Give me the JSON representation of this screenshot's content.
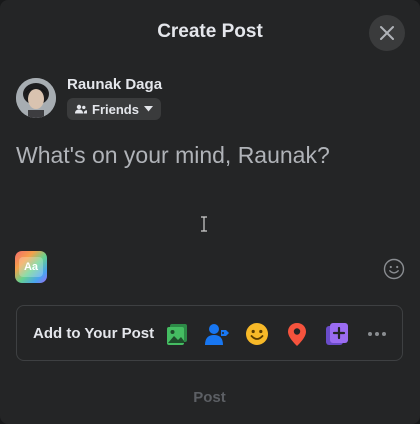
{
  "dialog": {
    "title": "Create Post",
    "close_icon": "close-icon"
  },
  "user": {
    "name": "Raunak Daga",
    "audience_label": "Friends",
    "audience_icon": "friends-icon"
  },
  "composer": {
    "placeholder": "What's on your mind, Raunak?"
  },
  "toolbar": {
    "background_picker_label": "Aa",
    "emoji_icon": "smiley-icon"
  },
  "add_to_post": {
    "label": "Add to Your Post",
    "items": [
      {
        "icon": "photo-video-icon",
        "color": "#45bd62"
      },
      {
        "icon": "tag-people-icon",
        "color": "#1877f2"
      },
      {
        "icon": "feeling-activity-icon",
        "color": "#f7b928"
      },
      {
        "icon": "check-in-icon",
        "color": "#f5533d"
      },
      {
        "icon": "gif-icon",
        "color": "#9b6cf2"
      },
      {
        "icon": "more-icon",
        "color": "#b0b3b8"
      }
    ]
  },
  "post_button": {
    "label": "Post"
  },
  "colors": {
    "dialog_bg": "#242526",
    "text_primary": "#e4e6eb",
    "text_secondary": "#b0b3b8"
  }
}
